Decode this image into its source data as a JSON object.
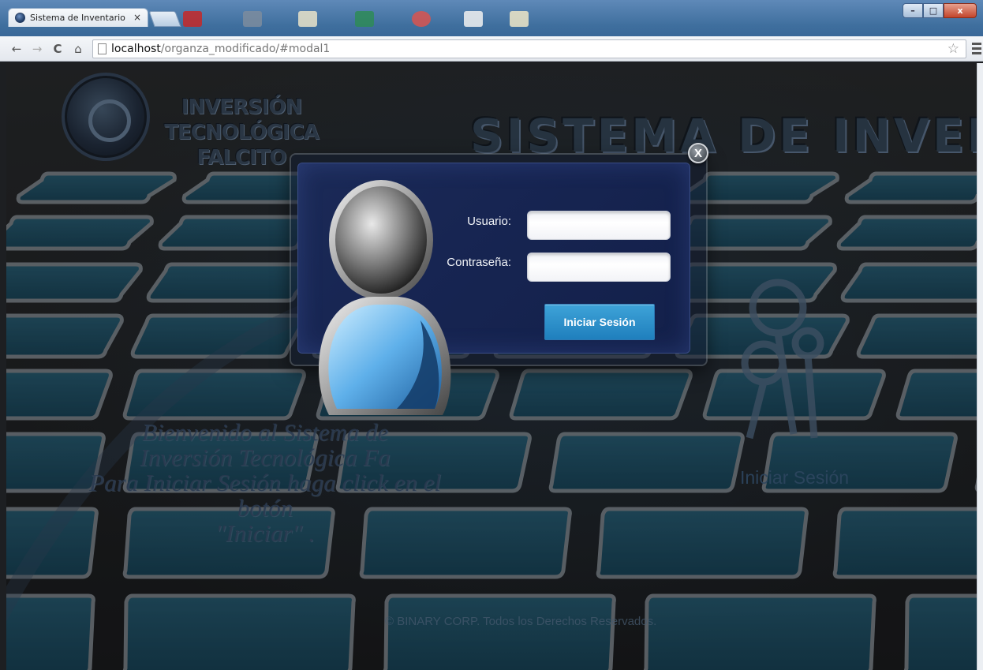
{
  "browser": {
    "tab_title": "Sistema de Inventario",
    "tab_close": "×",
    "url_host": "localhost",
    "url_path": "/organza_modificado/#modal1",
    "window_controls": {
      "minimize": "–",
      "maximize": "□",
      "close": "x"
    }
  },
  "header": {
    "logo_line1": "INVERSIÓN TECNOLÓGICA",
    "logo_line2": "FALCITO",
    "system_title": "SISTEMA DE INVENTARIO"
  },
  "welcome": {
    "line1": "Bienvenido al Sistema de",
    "line2": "Inversión Tecnológica Fa",
    "line3": "Para Iniciar Sesión haga click en el botón",
    "line4": "\"Iniciar\" ."
  },
  "right_panel": {
    "login_label": "Iniciar Sesión"
  },
  "footer": {
    "text": "© BINARY CORP. Todos los Derechos Reservados."
  },
  "modal": {
    "close_label": "X",
    "user_label": "Usuario:",
    "user_value": "",
    "password_label": "Contraseña:",
    "password_value": "",
    "submit_label": "Iniciar Sesión"
  },
  "colors": {
    "modal_bg": "#172552",
    "button_bg": "#2a8fca",
    "background": "#1d1f22"
  },
  "icons": [
    "back-icon",
    "forward-icon",
    "reload-icon",
    "home-icon",
    "page-icon",
    "star-icon",
    "menu-icon",
    "avatar-icon",
    "keys-icon",
    "globe-favicon"
  ]
}
